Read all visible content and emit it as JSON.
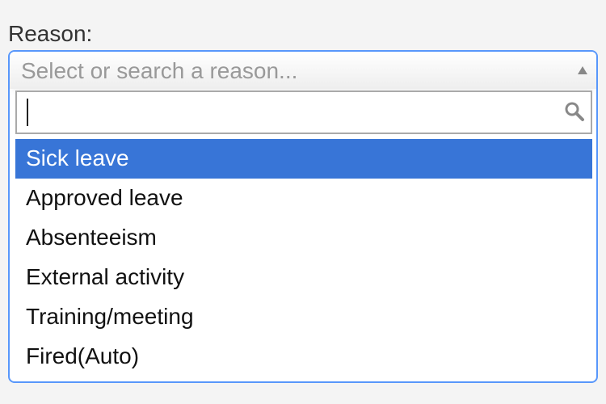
{
  "field": {
    "label": "Reason:"
  },
  "select": {
    "placeholder": "Select or search a reason...",
    "search_value": "",
    "options": [
      {
        "label": "Sick leave",
        "highlighted": true
      },
      {
        "label": "Approved leave",
        "highlighted": false
      },
      {
        "label": "Absenteeism",
        "highlighted": false
      },
      {
        "label": "External activity",
        "highlighted": false
      },
      {
        "label": "Training/meeting",
        "highlighted": false
      },
      {
        "label": "Fired(Auto)",
        "highlighted": false
      }
    ]
  },
  "colors": {
    "focus_border": "#5897fb",
    "highlight": "#3875d7",
    "placeholder_text": "#999999"
  },
  "icons": {
    "dropdown_arrow": "arrow-up-icon",
    "search": "search-icon"
  }
}
